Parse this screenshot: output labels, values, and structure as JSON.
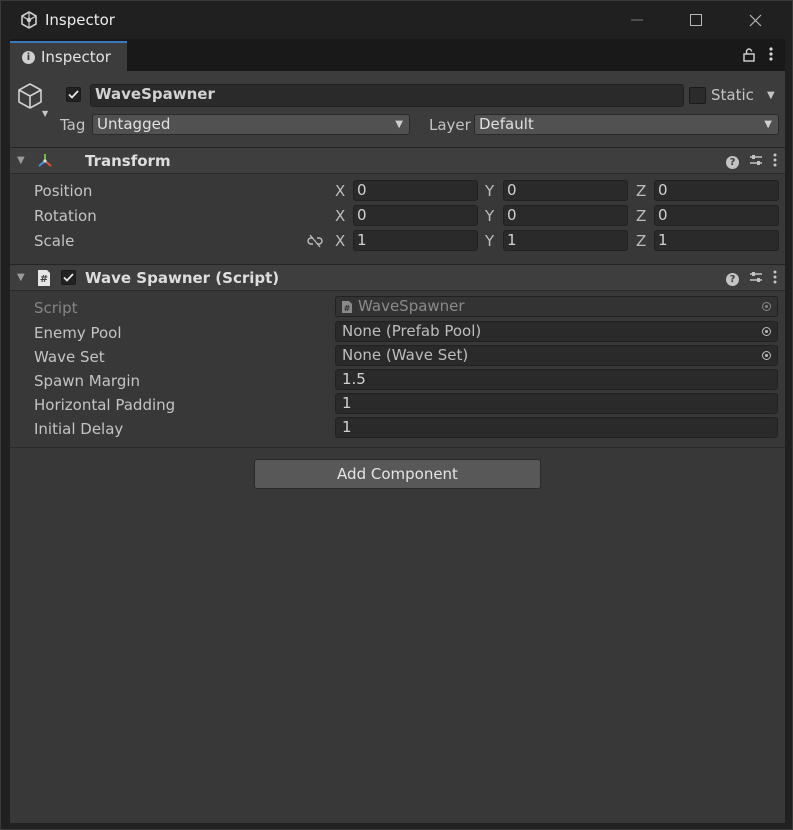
{
  "window": {
    "title": "Inspector",
    "tab_label": "Inspector"
  },
  "gameobject": {
    "active": true,
    "name": "WaveSpawner",
    "static_label": "Static",
    "static_checked": false,
    "tag_label": "Tag",
    "tag_value": "Untagged",
    "layer_label": "Layer",
    "layer_value": "Default"
  },
  "transform": {
    "title": "Transform",
    "rows": [
      {
        "label": "Position",
        "x": "0",
        "y": "0",
        "z": "0"
      },
      {
        "label": "Rotation",
        "x": "0",
        "y": "0",
        "z": "0"
      },
      {
        "label": "Scale",
        "x": "1",
        "y": "1",
        "z": "1"
      }
    ],
    "axis_labels": {
      "x": "X",
      "y": "Y",
      "z": "Z"
    }
  },
  "script_component": {
    "title": "Wave Spawner (Script)",
    "enabled": true,
    "fields": [
      {
        "label": "Script",
        "value": "WaveSpawner",
        "kind": "script"
      },
      {
        "label": "Enemy Pool",
        "value": "None (Prefab Pool)",
        "kind": "object"
      },
      {
        "label": "Wave Set",
        "value": "None (Wave Set)",
        "kind": "object"
      },
      {
        "label": "Spawn Margin",
        "value": "1.5",
        "kind": "float"
      },
      {
        "label": "Horizontal Padding",
        "value": "1",
        "kind": "float"
      },
      {
        "label": "Initial Delay",
        "value": "1",
        "kind": "float"
      }
    ]
  },
  "add_component_label": "Add Component",
  "icons": {
    "app": "unity-icon",
    "tab": "info-icon",
    "lock": "lock-icon",
    "menu": "kebab-icon",
    "gameobject": "cube-icon",
    "transform": "transform-axes-icon",
    "script": "script-hash-icon",
    "help": "help-icon",
    "presets": "presets-icon",
    "constrain": "constrain-proportions-icon"
  },
  "colors": {
    "panel": "#383838",
    "header": "#3e3e3e",
    "field": "#2a2a2a",
    "tab_accent": "#3a79bb"
  }
}
